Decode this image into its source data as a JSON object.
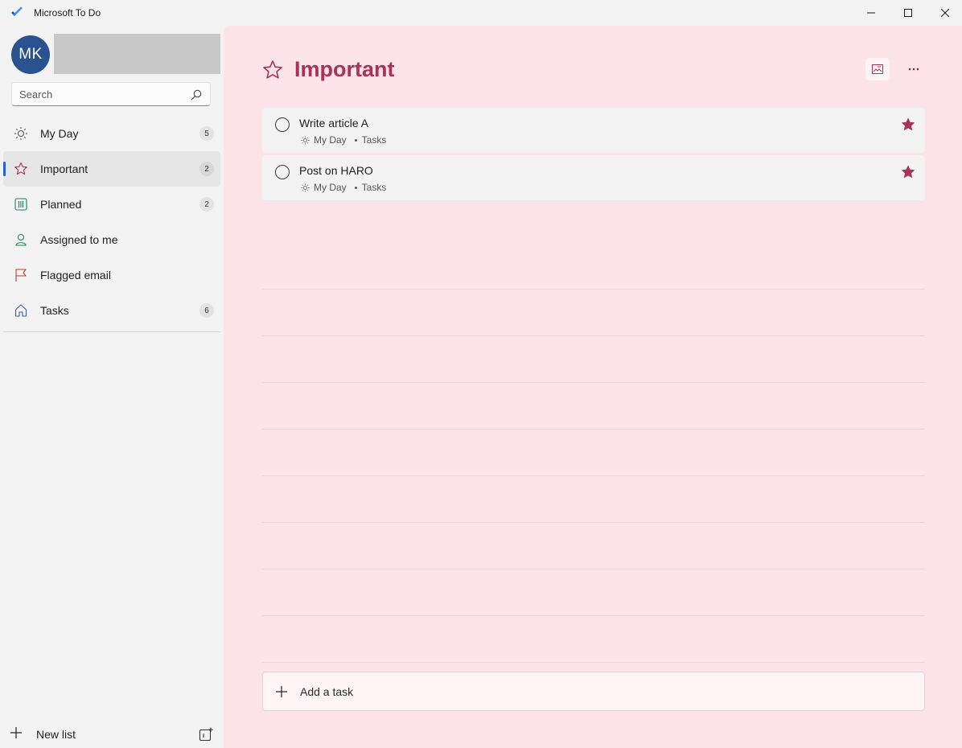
{
  "app": {
    "title": "Microsoft To Do"
  },
  "account": {
    "initials": "MK",
    "avatar_color": "#2a5290"
  },
  "search": {
    "placeholder": "Search"
  },
  "sidebar": {
    "items": [
      {
        "label": "My Day",
        "count": "5",
        "icon": "sun-icon"
      },
      {
        "label": "Important",
        "count": "2",
        "icon": "star-icon",
        "active": true
      },
      {
        "label": "Planned",
        "count": "2",
        "icon": "calendar-icon"
      },
      {
        "label": "Assigned to me",
        "count": "",
        "icon": "person-icon"
      },
      {
        "label": "Flagged email",
        "count": "",
        "icon": "flag-icon"
      },
      {
        "label": "Tasks",
        "count": "6",
        "icon": "home-icon"
      }
    ],
    "new_list_label": "New list"
  },
  "main": {
    "title": "Important",
    "accent_color": "#a83356",
    "background_color": "#fde4e9",
    "tasks": [
      {
        "title": "Write article A",
        "my_day": "My Day",
        "list": "Tasks",
        "starred": true
      },
      {
        "title": "Post on HARO",
        "my_day": "My Day",
        "list": "Tasks",
        "starred": true
      }
    ],
    "add_task_placeholder": "Add a task"
  }
}
